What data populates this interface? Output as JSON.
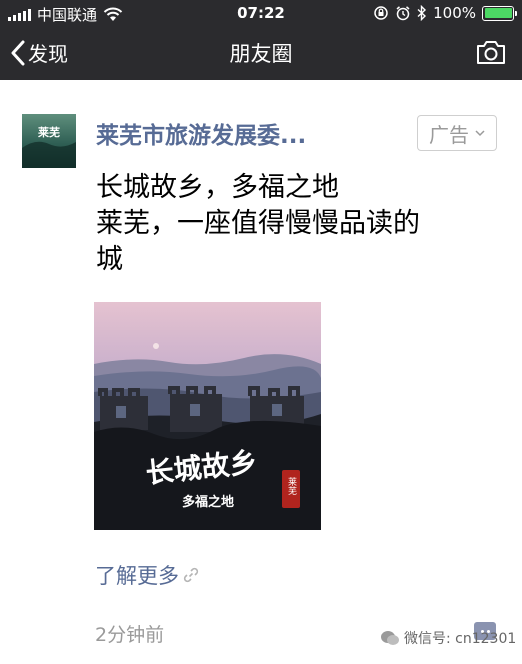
{
  "status_bar": {
    "carrier": "中国联通",
    "time": "07:22",
    "battery": "100%",
    "battery_level": 1.0,
    "icons": [
      "signal-icon",
      "wifi-icon",
      "orientation-lock-icon",
      "alarm-icon",
      "bluetooth-icon",
      "battery-icon"
    ]
  },
  "nav": {
    "back_label": "发现",
    "title": "朋友圈",
    "right_icon": "camera-icon"
  },
  "post": {
    "avatar_text": "莱芜",
    "author": "莱芜市旅游发展委...",
    "ad_label": "广告",
    "lines": [
      "长城故乡，多福之地",
      "莱芜，一座值得慢慢品读的",
      "城"
    ],
    "image": {
      "title": "长城故乡",
      "subtitle": "多福之地",
      "seal": "莱芜"
    },
    "learn_more": "了解更多",
    "time": "2分钟前"
  },
  "watermark": "微信号: cn12301",
  "colors": {
    "bar_bg": "#2b2b2e",
    "link": "#576b95",
    "battery": "#4cd964",
    "muted": "#9a9a9a"
  }
}
